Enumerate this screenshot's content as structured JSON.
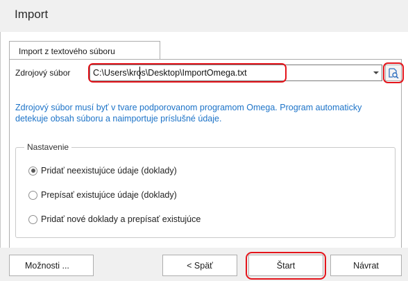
{
  "dialog": {
    "title": "Import"
  },
  "tabs": [
    {
      "label": "Import z textového súboru",
      "active": true
    }
  ],
  "source": {
    "label": "Zdrojový súbor",
    "value": "C:\\Users\\kros\\Desktop\\ImportOmega.txt",
    "browse_icon": "folder-search-icon"
  },
  "info_text": "Zdrojový súbor musí byť v tvare podporovanom programom Omega. Program automaticky detekuje obsah súboru a naimportuje príslušné údaje.",
  "settings": {
    "legend": "Nastavenie",
    "options": [
      {
        "label": "Pridať neexistujúce údaje (doklady)",
        "checked": true
      },
      {
        "label": "Prepísať existujúce údaje (doklady)",
        "checked": false
      },
      {
        "label": "Pridať nové doklady a prepísať existujúce",
        "checked": false
      }
    ]
  },
  "buttons": {
    "options": "Možnosti ...",
    "back": "< Späť",
    "start": "Štart",
    "return": "Návrat"
  },
  "colors": {
    "highlight": "#e4141b",
    "info_text": "#1c73c8",
    "header_bg": "#f0f0f0"
  }
}
